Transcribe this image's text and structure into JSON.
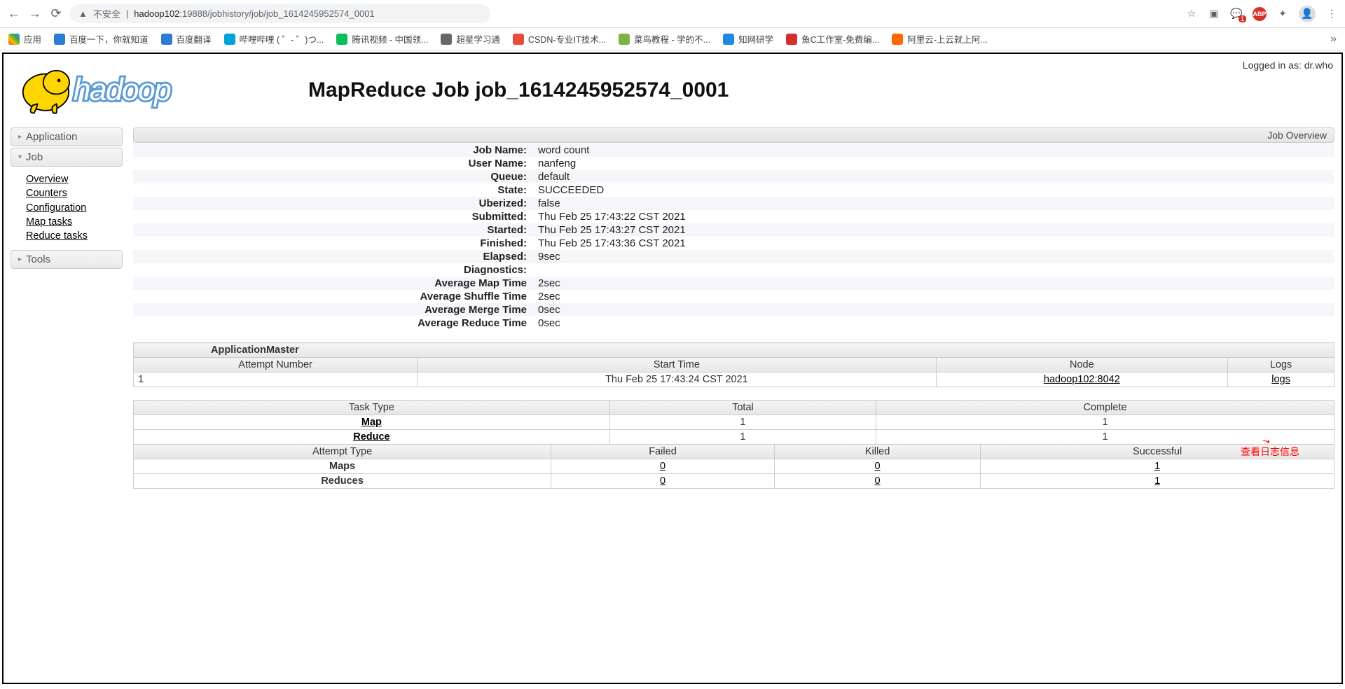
{
  "browser": {
    "insecure_label": "不安全",
    "url_host": "hadoop102",
    "url_path": ":19888/jobhistory/job/job_1614245952574_0001"
  },
  "bookmarks": {
    "apps": "应用",
    "items": [
      {
        "label": "百度一下，你就知道",
        "color": "#2b7cd3"
      },
      {
        "label": "百度翻译",
        "color": "#2b7cd3"
      },
      {
        "label": "哔哩哔哩 ( ゜- ゜)つ...",
        "color": "#00a1d6"
      },
      {
        "label": "腾讯视频 - 中国领...",
        "color": "#0abf5b"
      },
      {
        "label": "超星学习通",
        "color": "#666"
      },
      {
        "label": "CSDN-专业IT技术...",
        "color": "#e74c3c"
      },
      {
        "label": "菜鸟教程 - 学的不...",
        "color": "#7cb342"
      },
      {
        "label": "知网研学",
        "color": "#1e88e5"
      },
      {
        "label": "鱼C工作室-免费编...",
        "color": "#d32f2f"
      },
      {
        "label": "阿里云-上云就上阿...",
        "color": "#ff6a00"
      }
    ]
  },
  "login_status": "Logged in as: dr.who",
  "page_title": "MapReduce Job job_1614245952574_0001",
  "sidebar": {
    "application": "Application",
    "job": "Job",
    "job_items": [
      "Overview",
      "Counters",
      "Configuration",
      "Map tasks",
      "Reduce tasks"
    ],
    "tools": "Tools"
  },
  "overview_label": "Job Overview",
  "info": [
    {
      "label": "Job Name:",
      "value": "word count"
    },
    {
      "label": "User Name:",
      "value": "nanfeng"
    },
    {
      "label": "Queue:",
      "value": "default"
    },
    {
      "label": "State:",
      "value": "SUCCEEDED"
    },
    {
      "label": "Uberized:",
      "value": "false"
    },
    {
      "label": "Submitted:",
      "value": "Thu Feb 25 17:43:22 CST 2021"
    },
    {
      "label": "Started:",
      "value": "Thu Feb 25 17:43:27 CST 2021"
    },
    {
      "label": "Finished:",
      "value": "Thu Feb 25 17:43:36 CST 2021"
    },
    {
      "label": "Elapsed:",
      "value": "9sec"
    },
    {
      "label": "Diagnostics:",
      "value": ""
    },
    {
      "label": "Average Map Time",
      "value": "2sec"
    },
    {
      "label": "Average Shuffle Time",
      "value": "2sec"
    },
    {
      "label": "Average Merge Time",
      "value": "0sec"
    },
    {
      "label": "Average Reduce Time",
      "value": "0sec"
    }
  ],
  "appmaster": {
    "title": "ApplicationMaster",
    "headers": [
      "Attempt Number",
      "Start Time",
      "Node",
      "Logs"
    ],
    "rows": [
      {
        "attempt": "1",
        "start": "Thu Feb 25 17:43:24 CST 2021",
        "node": "hadoop102:8042",
        "logs": "logs"
      }
    ]
  },
  "tasktype": {
    "headers": [
      "Task Type",
      "Total",
      "Complete"
    ],
    "rows": [
      {
        "type": "Map",
        "total": "1",
        "complete": "1"
      },
      {
        "type": "Reduce",
        "total": "1",
        "complete": "1"
      }
    ]
  },
  "attempttype": {
    "headers": [
      "Attempt Type",
      "Failed",
      "Killed",
      "Successful"
    ],
    "rows": [
      {
        "type": "Maps",
        "failed": "0",
        "killed": "0",
        "successful": "1"
      },
      {
        "type": "Reduces",
        "failed": "0",
        "killed": "0",
        "successful": "1"
      }
    ]
  },
  "annotation": "查看日志信息"
}
